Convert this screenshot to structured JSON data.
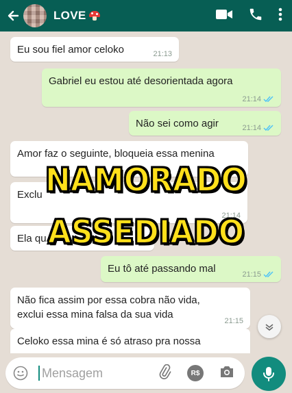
{
  "header": {
    "contact_name": "LOVE",
    "icons": [
      "back-arrow-icon",
      "avatar",
      "mushroom-icon",
      "video-call-icon",
      "phone-icon",
      "more-options-icon"
    ]
  },
  "colors": {
    "header_bg": "#075e54",
    "incoming_bubble": "#ffffff",
    "outgoing_bubble": "#dcf8c6",
    "chat_bg": "#e5ddd5",
    "read_ticks": "#4fc3f7",
    "overlay_text": "#ffe01b",
    "mic_button": "#128c7e"
  },
  "messages": [
    {
      "direction": "in",
      "text": "Eu sou fiel amor celoko",
      "time": "21:13"
    },
    {
      "direction": "out",
      "text": "Gabriel eu estou até desorientada agora",
      "time": "21:14",
      "read": true
    },
    {
      "direction": "out",
      "text": "Não sei como agir",
      "time": "21:14",
      "read": true
    },
    {
      "direction": "in",
      "text": "Amor faz o seguinte, bloqueia essa menina",
      "time": ""
    },
    {
      "direction": "in",
      "text": "Exclu",
      "time": "21:14"
    },
    {
      "direction": "in",
      "text": "Ela qu",
      "time": ""
    },
    {
      "direction": "out",
      "text": "Eu tô até passando mal",
      "time": "21:15",
      "read": true
    },
    {
      "direction": "in",
      "text": "Não fica assim por essa cobra não vida,\nexclui essa mina falsa da sua vida",
      "time": "21:15"
    },
    {
      "direction": "in",
      "text": "Celoko essa mina é só atraso pra nossa",
      "time": ""
    }
  ],
  "overlay": {
    "line1": "NAMORADO",
    "line2": "ASSEDIADO"
  },
  "composer": {
    "placeholder": "Mensagem",
    "currency_label": "R$",
    "icons": [
      "emoji-icon",
      "attach-icon",
      "payment-icon",
      "camera-icon",
      "mic-icon"
    ]
  }
}
